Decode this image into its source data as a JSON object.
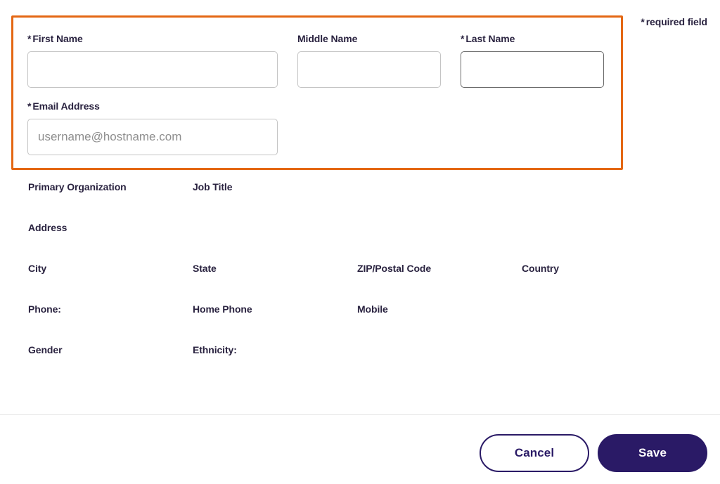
{
  "required_note_label": "required field",
  "required_marker": "*",
  "highlight": {
    "first_name_label": "First Name",
    "middle_name_label": "Middle Name",
    "last_name_label": "Last Name",
    "email_label": "Email Address",
    "email_placeholder": "username@hostname.com",
    "first_name_value": "",
    "middle_name_value": "",
    "last_name_value": "",
    "email_value": ""
  },
  "labels": {
    "primary_org": "Primary Organization",
    "job_title": "Job Title",
    "address": "Address",
    "city": "City",
    "state": "State",
    "zip": "ZIP/Postal Code",
    "country": "Country",
    "phone": "Phone:",
    "home_phone": "Home Phone",
    "mobile": "Mobile",
    "gender": "Gender",
    "ethnicity": "Ethnicity:"
  },
  "buttons": {
    "cancel": "Cancel",
    "save": "Save"
  },
  "colors": {
    "highlight_border": "#e46713",
    "primary_button": "#2a1a66"
  }
}
